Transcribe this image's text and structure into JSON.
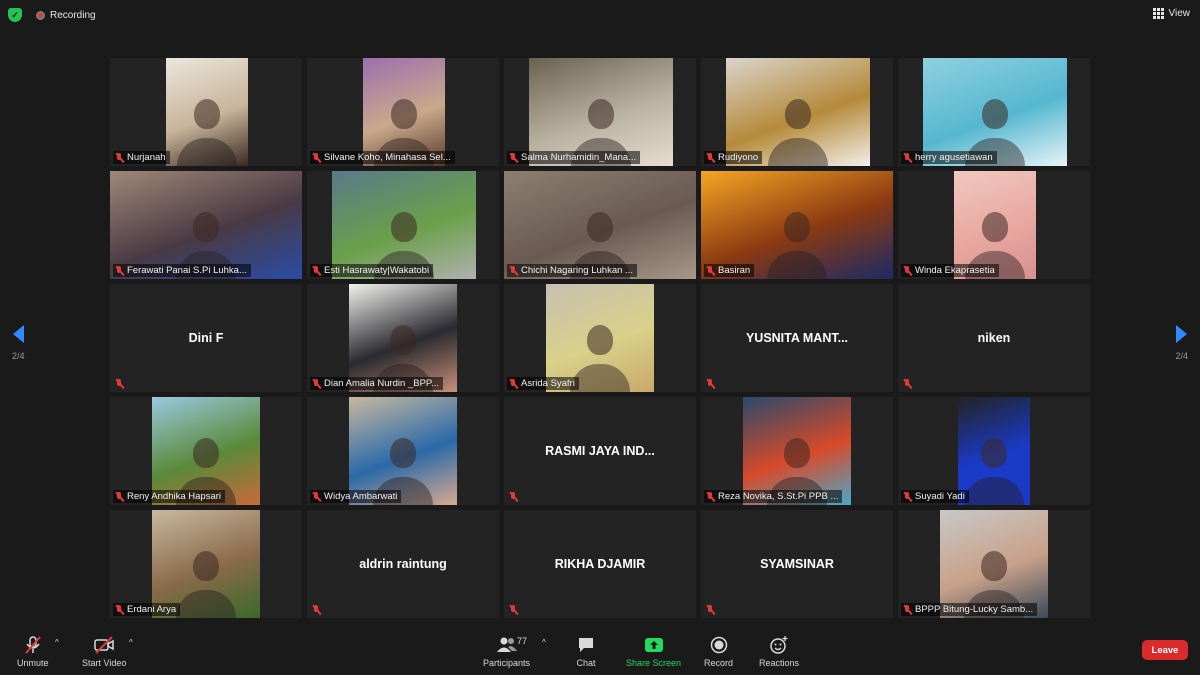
{
  "topbar": {
    "recording": "Recording",
    "view": "View"
  },
  "nav": {
    "page_left": "2/4",
    "page_right": "2/4"
  },
  "participants": [
    {
      "name": "Nurjanah",
      "video": true,
      "colors": [
        "#ece6dc",
        "#c7b49a",
        "#3a2a22"
      ],
      "vx": 56,
      "vw": 82
    },
    {
      "name": "Silvane Koho, Minahasa Sel...",
      "video": true,
      "colors": [
        "#9b6fb0",
        "#c9a98a",
        "#5b3a2a"
      ],
      "vx": 56,
      "vw": 82
    },
    {
      "name": "Salma Nurhamidin_Mana...",
      "video": true,
      "colors": [
        "#6b6150",
        "#b9b1a0",
        "#e8ddd0"
      ],
      "vx": 25,
      "vw": 144
    },
    {
      "name": "Rudiyono",
      "video": true,
      "colors": [
        "#d9d4cc",
        "#b58a3a",
        "#f2efe9"
      ],
      "vx": 25,
      "vw": 144
    },
    {
      "name": "herry agusetiawan",
      "video": true,
      "colors": [
        "#8fd0e0",
        "#55b7cf",
        "#e7f3f7"
      ],
      "vx": 25,
      "vw": 144
    },
    {
      "name": "Ferawati Panai S.Pi Luhka...",
      "video": true,
      "colors": [
        "#a08878",
        "#4a3a44",
        "#2a4ca8"
      ],
      "vx": 0,
      "vw": 192
    },
    {
      "name": "Esti Hasrawaty|Wakatobi",
      "video": true,
      "colors": [
        "#5a7a8a",
        "#6aa04a",
        "#b0b0b0"
      ],
      "vx": 25,
      "vw": 144
    },
    {
      "name": "Chichi Nagaring Luhkan ...",
      "video": true,
      "colors": [
        "#8a8070",
        "#6a5a52",
        "#a89888"
      ],
      "vx": 0,
      "vw": 192
    },
    {
      "name": "Basiran",
      "video": true,
      "colors": [
        "#f5a623",
        "#8b3a12",
        "#1c2a66"
      ],
      "vx": 0,
      "vw": 192
    },
    {
      "name": "Winda Ekaprasetia",
      "video": true,
      "colors": [
        "#f0c8c0",
        "#e8a8a0",
        "#d89090"
      ],
      "vx": 56,
      "vw": 82
    },
    {
      "name": "Dini F",
      "video": false
    },
    {
      "name": "Dian Amalia Nurdin _BPP...",
      "video": true,
      "colors": [
        "#f2f2ee",
        "#2a2a30",
        "#c89078"
      ],
      "vx": 42,
      "vw": 108
    },
    {
      "name": "Asrida Syafri",
      "video": true,
      "colors": [
        "#c8c0b0",
        "#d9d08a",
        "#c8a868"
      ],
      "vx": 42,
      "vw": 108
    },
    {
      "name": "YUSNITA  MANT...",
      "video": false
    },
    {
      "name": "niken",
      "video": false
    },
    {
      "name": "Reny Andhika Hapsari",
      "video": true,
      "colors": [
        "#9ac8e0",
        "#5a8a3a",
        "#c86a3a"
      ],
      "vx": 42,
      "vw": 108
    },
    {
      "name": "Widya Ambarwati",
      "video": true,
      "colors": [
        "#c8b8a0",
        "#2a6aa8",
        "#d8a890"
      ],
      "vx": 42,
      "vw": 108
    },
    {
      "name": "RASMI  JAYA  IND...",
      "video": false
    },
    {
      "name": "Reza Novika, S.St.Pi PPB ...",
      "video": true,
      "colors": [
        "#2a4a6a",
        "#d84a2a",
        "#4aa8c8"
      ],
      "vx": 42,
      "vw": 108
    },
    {
      "name": "Suyadi Yadi",
      "video": true,
      "colors": [
        "#232323",
        "#1a3ac8",
        "#1a3ac8"
      ],
      "vx": 60,
      "vw": 72
    },
    {
      "name": "Erdani Arya",
      "video": true,
      "colors": [
        "#c8b8a0",
        "#8a6a4a",
        "#3a6a2a"
      ],
      "vx": 42,
      "vw": 108
    },
    {
      "name": "aldrin raintung",
      "video": false
    },
    {
      "name": "RIKHA DJAMIR",
      "video": false
    },
    {
      "name": "SYAMSINAR",
      "video": false
    },
    {
      "name": "BPPP Bitung-Lucky Samb...",
      "video": true,
      "colors": [
        "#c8c8c8",
        "#c8a088",
        "#3a4a5a"
      ],
      "vx": 42,
      "vw": 108
    }
  ],
  "toolbar": {
    "unmute": "Unmute",
    "start_video": "Start Video",
    "participants": "Participants",
    "participants_count": "77",
    "chat": "Chat",
    "share_screen": "Share Screen",
    "record": "Record",
    "reactions": "Reactions",
    "leave": "Leave"
  }
}
